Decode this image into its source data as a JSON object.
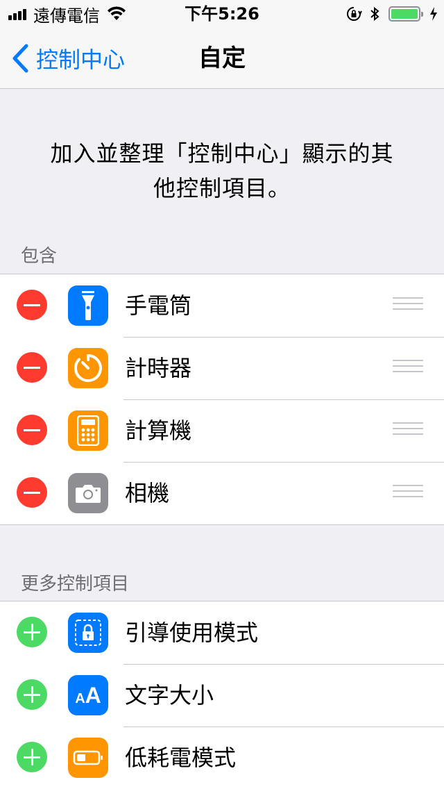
{
  "status_bar": {
    "carrier": "遠傳電信",
    "time": "下午5:26"
  },
  "nav": {
    "back_label": "控制中心",
    "title": "自定"
  },
  "description": {
    "line1": "加入並整理「控制中心」顯示的其",
    "line2": "他控制項目。"
  },
  "included": {
    "header": "包含",
    "items": [
      {
        "label": "手電筒",
        "icon": "flashlight-icon",
        "color": "#007aff"
      },
      {
        "label": "計時器",
        "icon": "timer-icon",
        "color": "#ff9500"
      },
      {
        "label": "計算機",
        "icon": "calculator-icon",
        "color": "#ff9500"
      },
      {
        "label": "相機",
        "icon": "camera-icon",
        "color": "#8e8e93"
      }
    ]
  },
  "more": {
    "header": "更多控制項目",
    "items": [
      {
        "label": "引導使用模式",
        "icon": "guided-access-icon",
        "color": "#007aff"
      },
      {
        "label": "文字大小",
        "icon": "text-size-icon",
        "color": "#007aff",
        "glyph": "AA"
      },
      {
        "label": "低耗電模式",
        "icon": "low-power-icon",
        "color": "#ff9500"
      }
    ]
  },
  "colors": {
    "accent": "#007aff",
    "remove": "#ff3b30",
    "add": "#4cd964",
    "battery": "#4cd964"
  }
}
